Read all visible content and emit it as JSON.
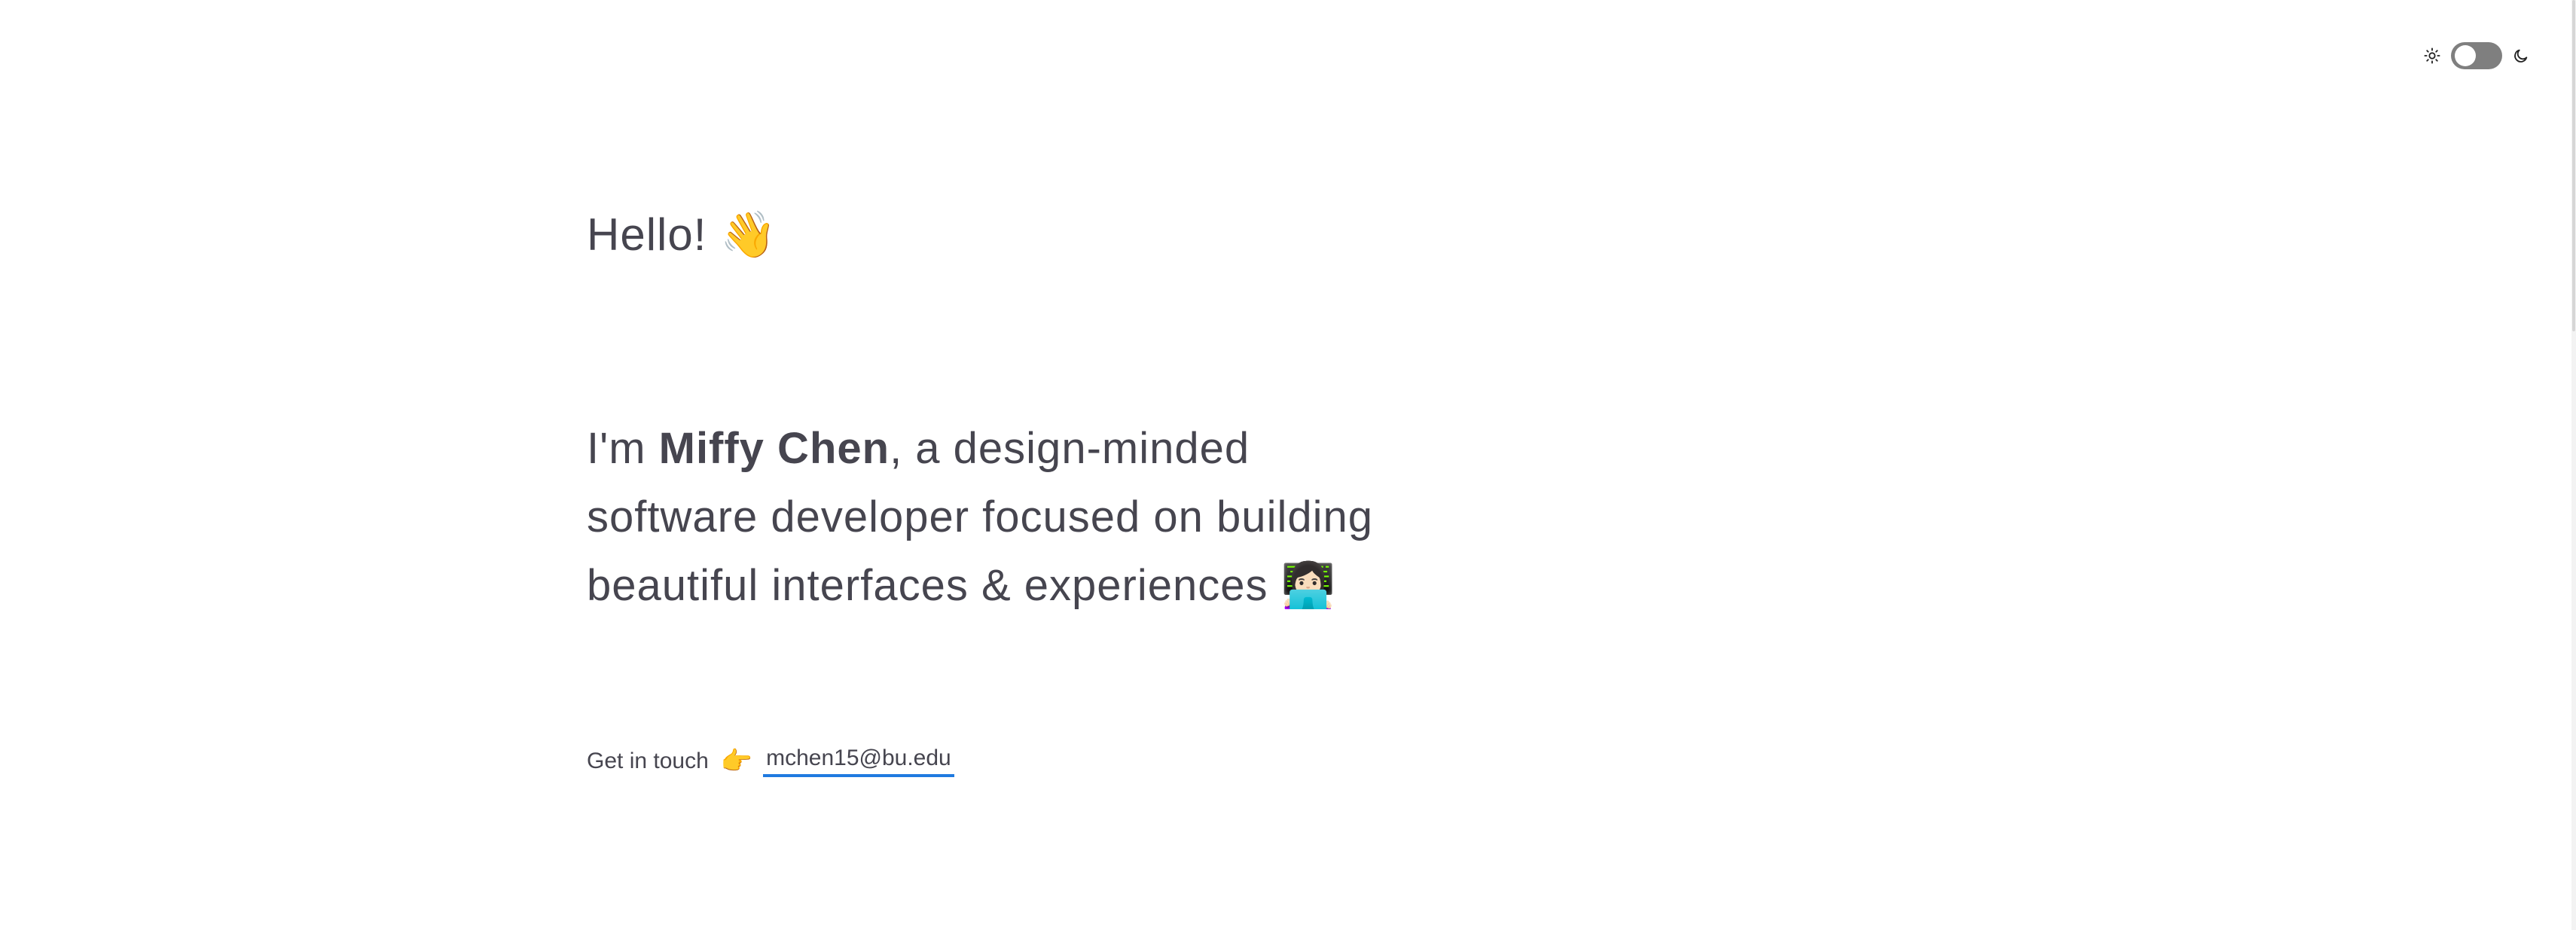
{
  "theme_toggle": {
    "light_icon": "sun-icon",
    "dark_icon": "moon-icon",
    "state": "light"
  },
  "hero": {
    "greeting": "Hello!",
    "greeting_emoji": "👋",
    "intro_prefix": "I'm ",
    "name": "Miffy Chen",
    "intro_line1_rest": ", a design-minded",
    "intro_line2": "software developer focused on building",
    "intro_line3": "beautiful interfaces & experiences",
    "intro_emoji": "👩🏻‍💻"
  },
  "contact": {
    "label": "Get in touch",
    "pointer_emoji": "👉",
    "email": "mchen15@bu.edu"
  },
  "colors": {
    "text": "#46454f",
    "link_underline": "#1f7ae0",
    "toggle_track": "#7f7f7f"
  }
}
